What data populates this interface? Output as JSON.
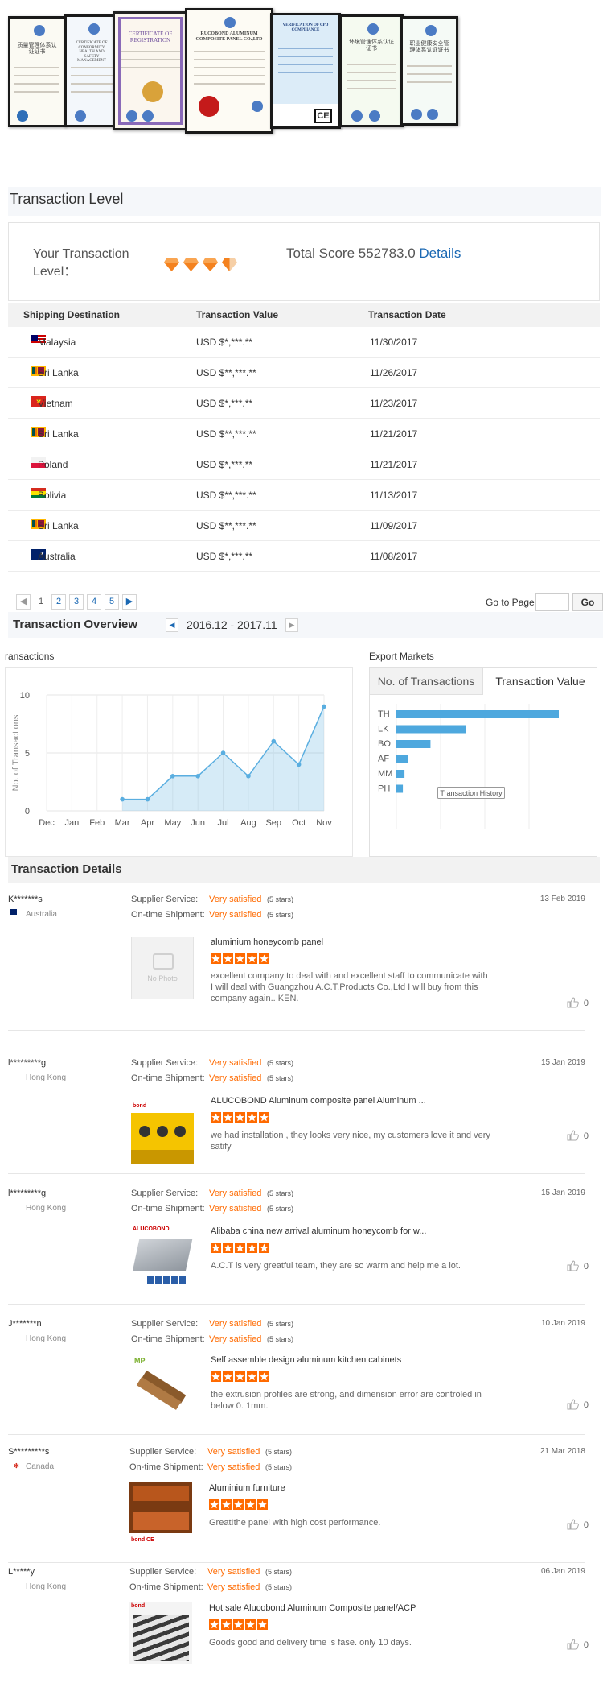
{
  "certificates": [
    {
      "title": "质量管理体系认证证书"
    },
    {
      "title": "CERTIFICATE OF CONFORMITY HEALTH AND SAFETY MANAGEMENT"
    },
    {
      "title": "CERTIFICATE OF REGISTRATION"
    },
    {
      "title": "RUCOBOND ALUMINUM COMPOSITE PANEL CO.,LTD"
    },
    {
      "title": "VERIFICATION OF CPD COMPLIANCE"
    },
    {
      "title": "环境管理体系认证证书"
    },
    {
      "title": "职业健康安全管理体系认证证书"
    }
  ],
  "transaction_level": {
    "title": "Transaction Level",
    "label": "Your Transaction Level：",
    "diamonds": 3.5,
    "score_label": "Total Score 552783.0",
    "details_link": "Details"
  },
  "shipping_table": {
    "headers": [
      "Shipping Destination",
      "Transaction Value",
      "Transaction Date"
    ],
    "rows": [
      {
        "country": "Malaysia",
        "value": "USD $*,***.**",
        "date": "11/30/2017",
        "flag": "malaysia"
      },
      {
        "country": "Sri Lanka",
        "value": "USD $**,***.**",
        "date": "11/26/2017",
        "flag": "srilanka"
      },
      {
        "country": "Vietnam",
        "value": "USD $*,***.**",
        "date": "11/23/2017",
        "flag": "vietnam"
      },
      {
        "country": "Sri Lanka",
        "value": "USD $**,***.**",
        "date": "11/21/2017",
        "flag": "srilanka"
      },
      {
        "country": "Poland",
        "value": "USD $*,***.**",
        "date": "11/21/2017",
        "flag": "poland"
      },
      {
        "country": "Bolivia",
        "value": "USD $**,***.**",
        "date": "11/13/2017",
        "flag": "bolivia"
      },
      {
        "country": "Sri Lanka",
        "value": "USD $**,***.**",
        "date": "11/09/2017",
        "flag": "srilanka"
      },
      {
        "country": "Australia",
        "value": "USD $*,***.**",
        "date": "11/08/2017",
        "flag": "australia"
      }
    ]
  },
  "pagination": {
    "prev_icon": "chevron-left-icon",
    "pages": [
      "1",
      "2",
      "3",
      "4",
      "5"
    ],
    "current": "1",
    "next_icon": "chevron-right-icon",
    "goto_label": "Go to Page",
    "goto_value": "",
    "go_button": "Go"
  },
  "overview": {
    "title": "Transaction Overview",
    "range": "2016.12 - 2017.11"
  },
  "chart_data": [
    {
      "type": "area",
      "title": "ransactions",
      "ylabel": "No. of Transactions",
      "categories": [
        "Dec",
        "Jan",
        "Feb",
        "Mar",
        "Apr",
        "May",
        "Jun",
        "Jul",
        "Aug",
        "Sep",
        "Oct",
        "Nov"
      ],
      "values": [
        null,
        null,
        null,
        1,
        1,
        3,
        3,
        5,
        3,
        6,
        4,
        9
      ],
      "ylim": [
        0,
        10
      ],
      "yticks": [
        0,
        5,
        10
      ],
      "color": "#5aaee0",
      "grid": true
    },
    {
      "type": "bar",
      "title": "Export Markets",
      "orientation": "horizontal",
      "categories": [
        "TH",
        "LK",
        "BO",
        "AF",
        "MM",
        "PH"
      ],
      "values": [
        100,
        43,
        21,
        7,
        5,
        4
      ],
      "color": "#4ea8de",
      "tabs": [
        "No. of Transactions",
        "Transaction Value"
      ],
      "active_tab": "Transaction Value",
      "tooltip": "Transaction History"
    }
  ],
  "details": {
    "title": "Transaction Details",
    "supplier_label": "Supplier Service:",
    "shipment_label": "On-time Shipment:",
    "satisfied": "Very satisfied",
    "stars_text": "(5 stars)",
    "no_photo": "No Photo",
    "reviews": [
      {
        "name": "K*******s",
        "country": "Australia",
        "date": "13 Feb 2019",
        "product": "aluminium honeycomb panel",
        "text": "excellent company to deal with and excellent staff to communicate with I will deal with Guangzhou A.C.T.Products Co.,Ltd I will buy from this company again.. KEN.",
        "likes": "0",
        "image": "none"
      },
      {
        "name": "l*********g",
        "country": "Hong Kong",
        "date": "15 Jan 2019",
        "product": "ALUCOBOND Aluminum composite panel Aluminum ...",
        "text": "we had installation , they looks very nice, my customers love it and very satify",
        "likes": "0",
        "image": "yellow"
      },
      {
        "name": "l*********g",
        "country": "Hong Kong",
        "date": "15 Jan 2019",
        "product": "Alibaba china new arrival aluminum honeycomb for w...",
        "text": "A.C.T is very greatful team, they are so warm and help me a lot.",
        "likes": "0",
        "image": "honeycomb"
      },
      {
        "name": "J*******n",
        "country": "Hong Kong",
        "date": "10 Jan 2019",
        "product": "Self assemble design aluminum kitchen cabinets",
        "text": "the extrusion profiles are strong, and dimension error are controled in below 0. 1mm.",
        "likes": "0",
        "image": "profile"
      },
      {
        "name": "S*********s",
        "country": "Canada",
        "date": "21 Mar 2018",
        "product": "Aluminium furniture",
        "text": "Great!the panel with high cost performance.",
        "likes": "0",
        "image": "kitchen"
      },
      {
        "name": "L*****y",
        "country": "Hong Kong",
        "date": "06 Jan 2019",
        "product": "Hot sale Alucobond Aluminum Composite panel/ACP",
        "text": "Goods good and delivery time is fase. only 10 days.",
        "likes": "0",
        "image": "stairs"
      }
    ]
  }
}
